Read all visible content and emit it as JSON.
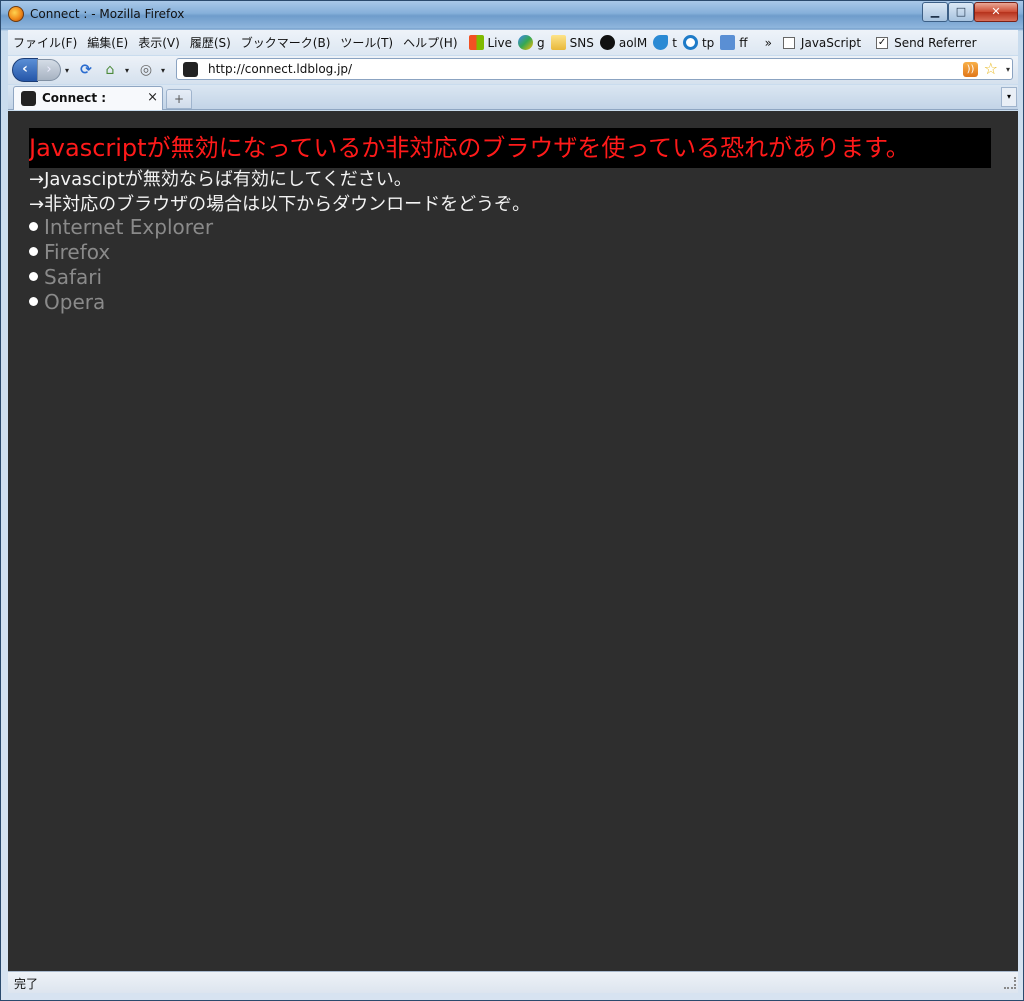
{
  "window": {
    "title": "Connect : - Mozilla Firefox",
    "minimize_label": "▁",
    "maximize_label": "□",
    "close_label": "✕"
  },
  "menubar": {
    "items": [
      {
        "label": "ファイル(F)"
      },
      {
        "label": "編集(E)"
      },
      {
        "label": "表示(V)"
      },
      {
        "label": "履歴(S)"
      },
      {
        "label": "ブックマーク(B)"
      },
      {
        "label": "ツール(T)"
      },
      {
        "label": "ヘルプ(H)"
      }
    ],
    "bookmarks": [
      {
        "label": "Live",
        "icon": "windows-icon"
      },
      {
        "label": "g",
        "icon": "google-icon"
      },
      {
        "label": "SNS",
        "icon": "folder-icon"
      },
      {
        "label": "aolM",
        "icon": "aol-icon"
      },
      {
        "label": "t",
        "icon": "twitter-icon"
      },
      {
        "label": "tp",
        "icon": "tp-icon"
      },
      {
        "label": "ff",
        "icon": "friendfeed-icon"
      }
    ],
    "overflow_label": "»",
    "javascript_toggle": {
      "label": "JavaScript",
      "checked": false
    },
    "send_referrer_toggle": {
      "label": "Send Referrer",
      "checked": true,
      "check_mark": "✓"
    }
  },
  "navbar": {
    "back_label": "‹",
    "forward_label": "›",
    "dropdown_label": "▾",
    "reload_icon": "⟳",
    "home_icon": "⌂",
    "globe_icon": "◎",
    "url": "http://connect.ldblog.jp/",
    "rss_label": "))",
    "star_label": "☆"
  },
  "tabs": {
    "items": [
      {
        "label": "Connect :",
        "close_label": "×"
      }
    ],
    "new_tab_label": "+",
    "list_label": "▾"
  },
  "content": {
    "warning": "Javascriptが無効になっているか非対応のブラウザを使っている恐れがあります。",
    "line1": "→Javasciptが無効ならば有効にしてください。",
    "line2": "→非対応のブラウザの場合は以下からダウンロードをどうぞ。",
    "browsers": [
      {
        "label": "Internet Explorer"
      },
      {
        "label": "Firefox"
      },
      {
        "label": "Safari"
      },
      {
        "label": "Opera"
      }
    ]
  },
  "statusbar": {
    "text": "完了"
  },
  "colors": {
    "content_bg": "#2e2e2e",
    "warning_text": "#ff1a1a",
    "warning_bg": "#000000",
    "link_text": "#8a8a8a"
  }
}
